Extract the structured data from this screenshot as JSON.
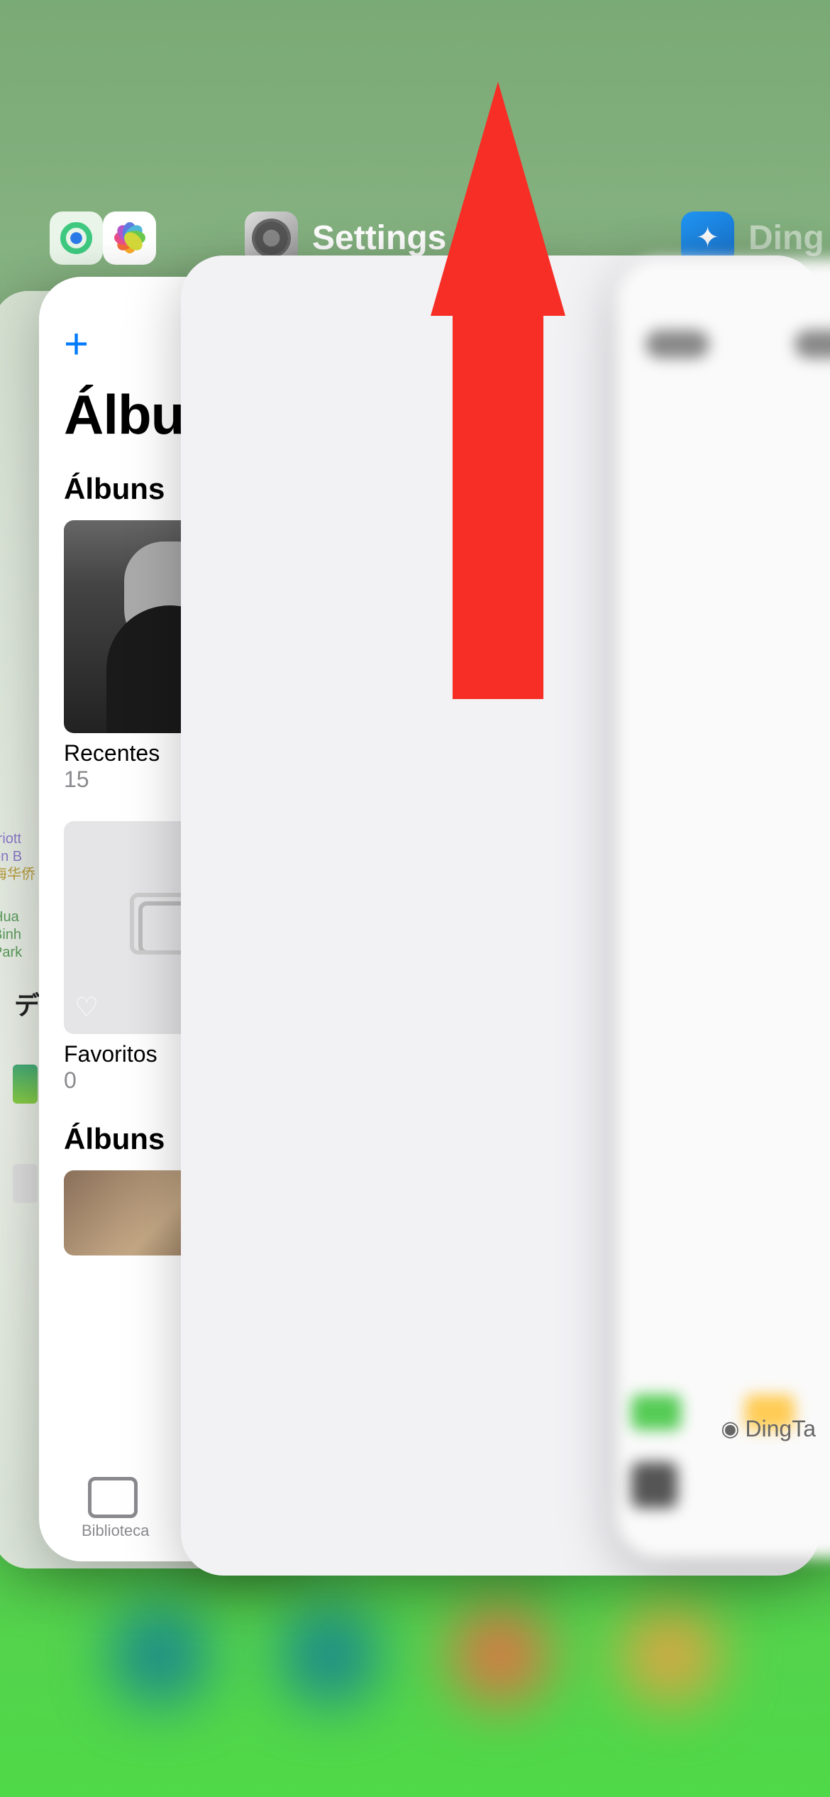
{
  "app_switcher": {
    "settings_label": "Settings",
    "dingtalk_label": "Ding"
  },
  "photos_card": {
    "add_symbol": "+",
    "title": "Álbun",
    "section_albums": "Álbuns",
    "recents": {
      "name": "Recentes",
      "count": "15"
    },
    "favorites": {
      "name": "Favoritos",
      "count": "0"
    },
    "section_albums2": "Álbuns",
    "tab_label": "Biblioteca"
  },
  "maps_card": {
    "label1": "rriott",
    "label2": "en B",
    "label3": "海华侨",
    "label4": "Hua",
    "label5": "Binh",
    "label6": "Park",
    "jp_label": "デ"
  },
  "dingtalk_card": {
    "footer": "DingTa"
  }
}
